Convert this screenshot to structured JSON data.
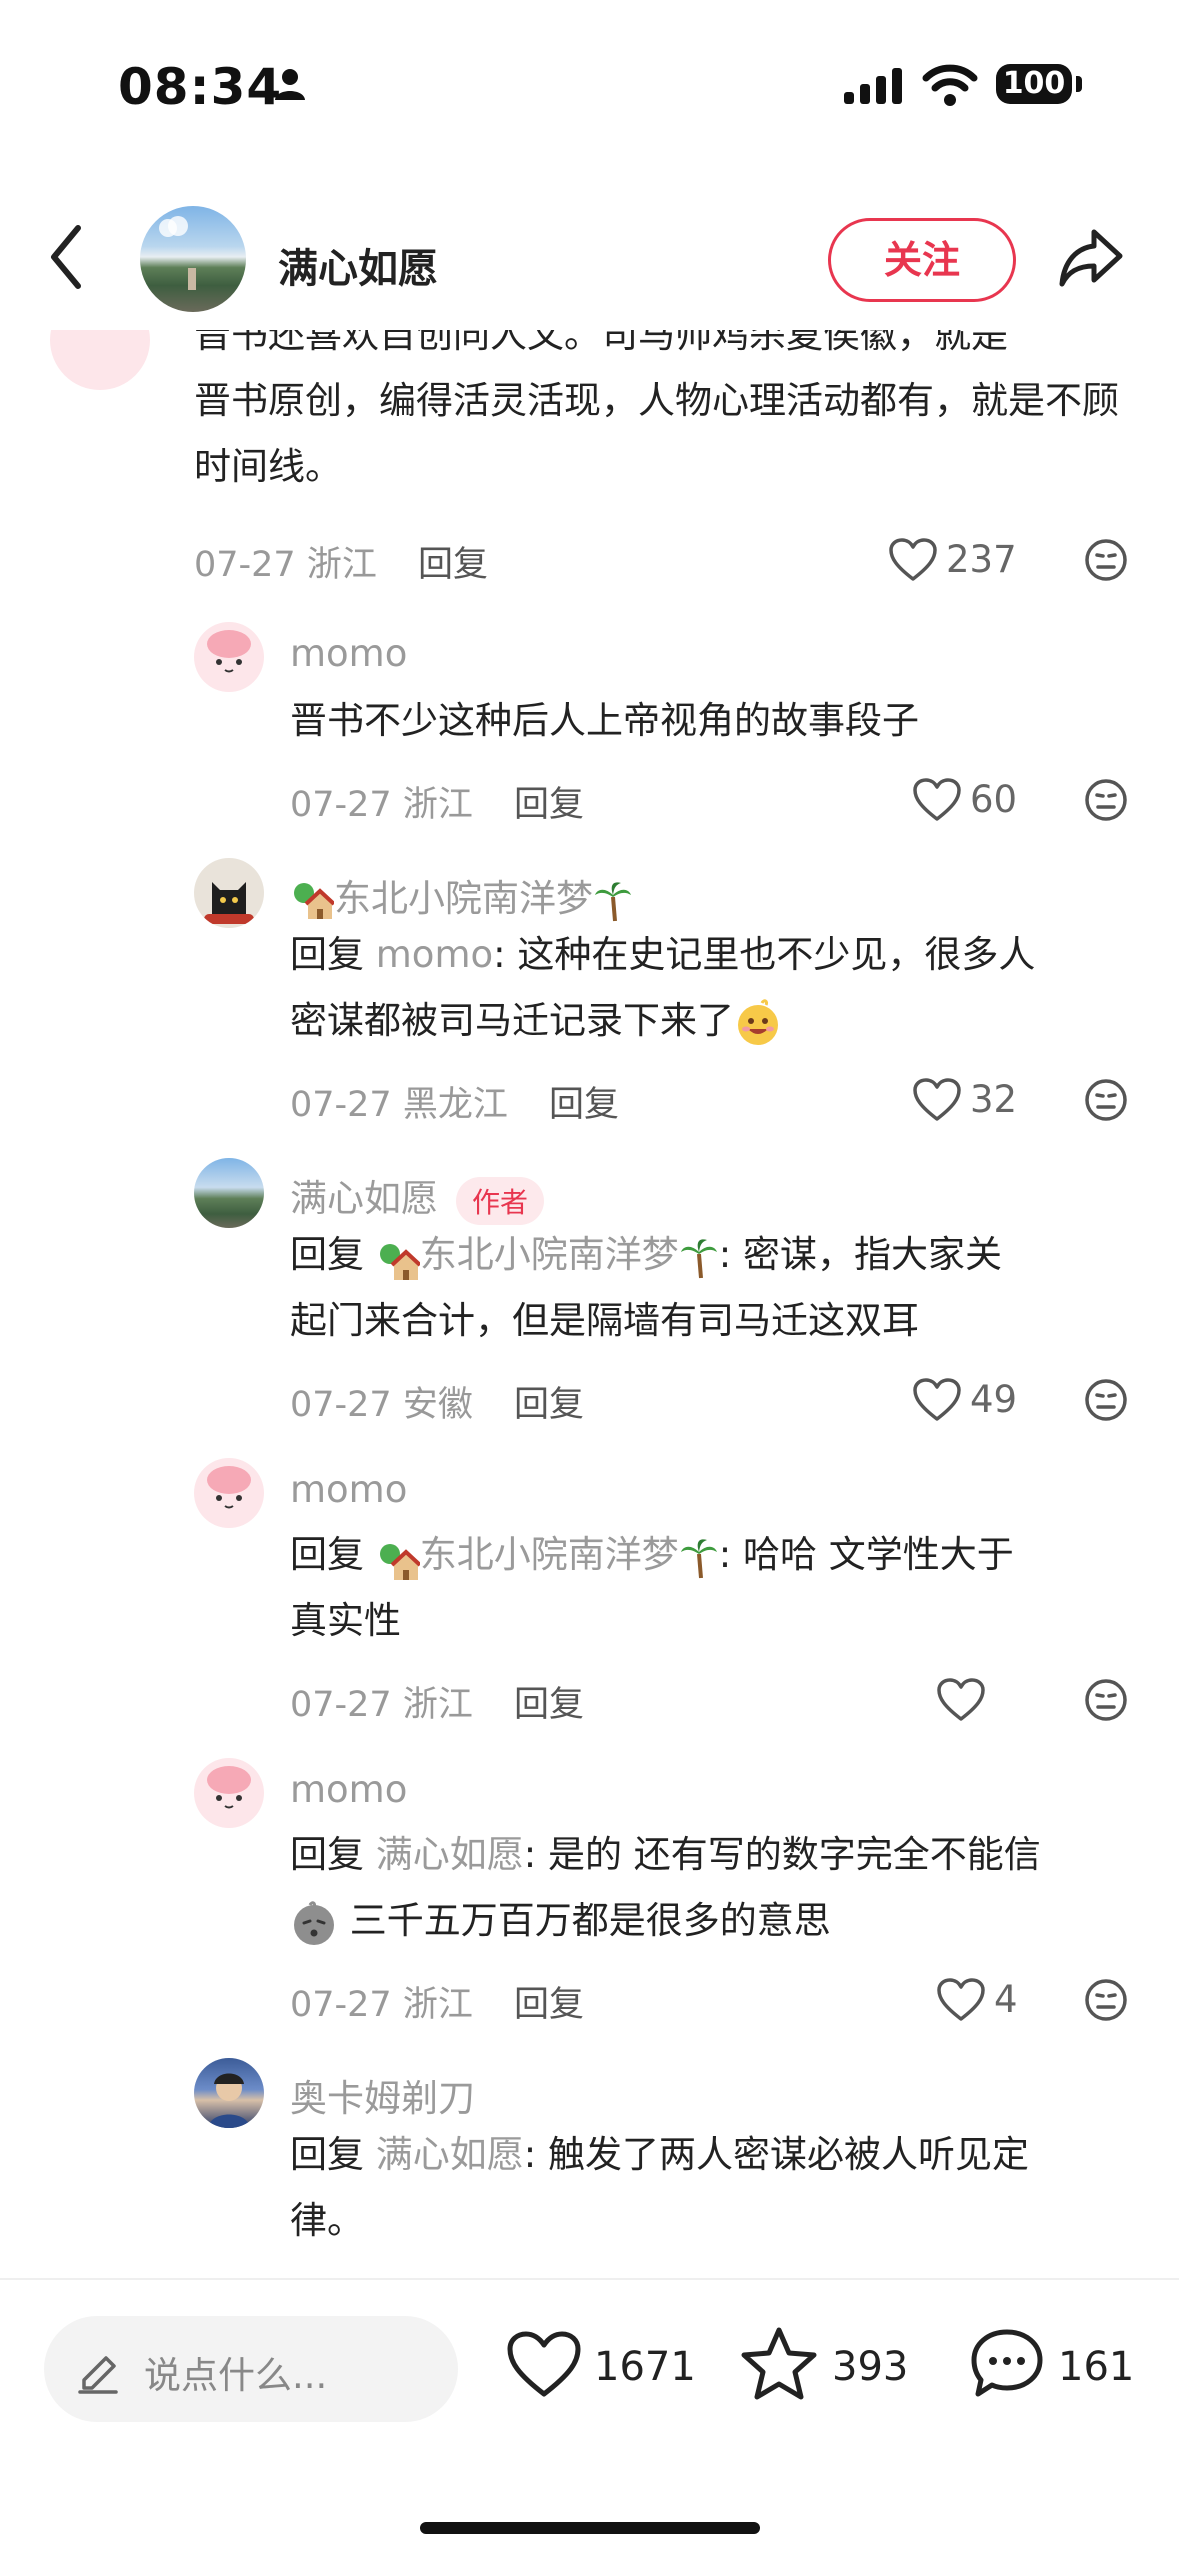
{
  "status_bar": {
    "time": "08:34",
    "battery": "100",
    "icons": [
      "person-icon",
      "signal-icon",
      "wifi-icon",
      "battery-icon"
    ]
  },
  "header": {
    "author_name": "满心如愿",
    "follow_label": "关注",
    "icons": [
      "back-chevron-icon",
      "share-icon"
    ]
  },
  "top_comment": {
    "text_partial": "晋书还喜欢自创同人文。司马帅鸡杀夏侯徽，就是",
    "text": "晋书原创，编得活灵活现，人物心理活动都有，就是不顾时间线。",
    "date": "07-27",
    "location": "浙江",
    "reply_label": "回复",
    "likes": "237"
  },
  "replies": [
    {
      "user": "momo",
      "text": "晋书不少这种后人上帝视角的故事段子",
      "date": "07-27",
      "location": "浙江",
      "reply_label": "回复",
      "likes": "60"
    },
    {
      "user": "东北小院南洋梦",
      "prefix": "回复 ",
      "mention": "momo",
      "text_a": ": 这种在史记里也不少见，很多人",
      "text_b": "密谋都被司马迁记录下来了",
      "date": "07-27",
      "location": "黑龙江",
      "reply_label": "回复",
      "likes": "32"
    },
    {
      "user": "满心如愿",
      "tag": "作者",
      "prefix": "回复 ",
      "mention": "东北小院南洋梦",
      "text_a": ": 密谋，指大家关",
      "text_b": "起门来合计，但是隔墙有司马迁这双耳",
      "date": "07-27",
      "location": "安徽",
      "reply_label": "回复",
      "likes": "49"
    },
    {
      "user": "momo",
      "prefix": "回复 ",
      "mention": "东北小院南洋梦",
      "text_a": ": 哈哈 文学性大于",
      "text_b": "真实性",
      "date": "07-27",
      "location": "浙江",
      "reply_label": "回复",
      "likes": ""
    },
    {
      "user": "momo",
      "prefix": "回复 ",
      "mention": "满心如愿",
      "text_a": ": 是的 还有写的数字完全不能信",
      "text_b": "三千五万百万都是很多的意思",
      "date": "07-27",
      "location": "浙江",
      "reply_label": "回复",
      "likes": "4"
    },
    {
      "user": "奥卡姆剃刀",
      "prefix": "回复 ",
      "mention": "满心如愿",
      "text_a": ": 触发了两人密谋必被人听见定",
      "text_b": "律。"
    }
  ],
  "bottom_bar": {
    "placeholder": "说点什么...",
    "likes": "1671",
    "favorites": "393",
    "comments": "161"
  },
  "colors": {
    "accent": "#e8364f",
    "muted": "#999999",
    "text": "#222222",
    "background": "#ffffff"
  }
}
